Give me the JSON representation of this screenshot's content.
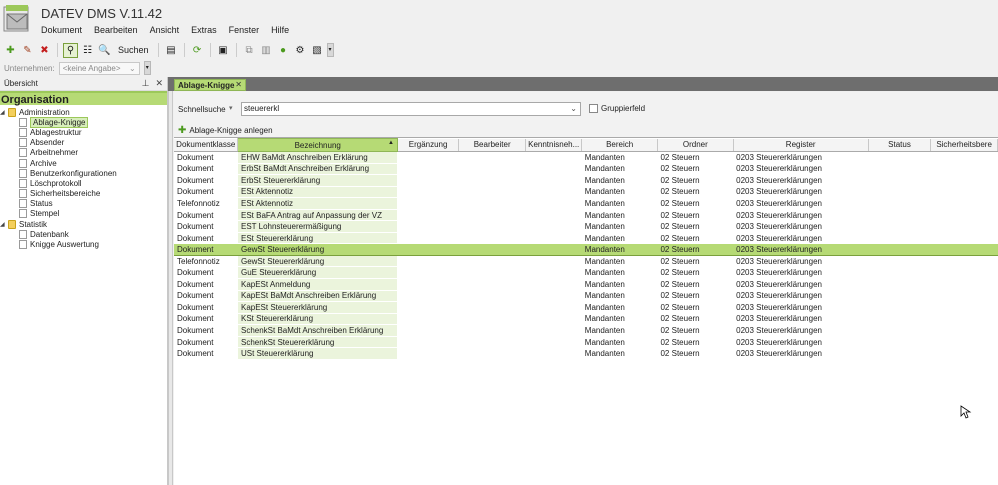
{
  "app": {
    "title": "DATEV DMS V.11.42"
  },
  "menu": [
    {
      "label": "Dokument"
    },
    {
      "label": "Bearbeiten"
    },
    {
      "label": "Ansicht"
    },
    {
      "label": "Extras"
    },
    {
      "label": "Fenster"
    },
    {
      "label": "Hilfe"
    }
  ],
  "toolbar": {
    "search_label": "Suchen"
  },
  "company": {
    "label": "Unternehmen:",
    "value": "<keine Angabe>"
  },
  "leftpane": {
    "header": "Übersicht",
    "org_title": "Organisation",
    "tree": [
      {
        "label": "Administration",
        "level": 1,
        "type": "folder",
        "expanded": true
      },
      {
        "label": "Ablage-Knigge",
        "level": 2,
        "type": "doc",
        "selected": true
      },
      {
        "label": "Ablagestruktur",
        "level": 2,
        "type": "doc"
      },
      {
        "label": "Absender",
        "level": 2,
        "type": "doc"
      },
      {
        "label": "Arbeitnehmer",
        "level": 2,
        "type": "doc"
      },
      {
        "label": "Archive",
        "level": 2,
        "type": "doc"
      },
      {
        "label": "Benutzerkonfigurationen",
        "level": 2,
        "type": "doc"
      },
      {
        "label": "Löschprotokoll",
        "level": 2,
        "type": "doc"
      },
      {
        "label": "Sicherheitsbereiche",
        "level": 2,
        "type": "doc"
      },
      {
        "label": "Status",
        "level": 2,
        "type": "doc"
      },
      {
        "label": "Stempel",
        "level": 2,
        "type": "doc"
      },
      {
        "label": "Statistik",
        "level": 1,
        "type": "folder",
        "expanded": true
      },
      {
        "label": "Datenbank",
        "level": 2,
        "type": "doc"
      },
      {
        "label": "Knigge Auswertung",
        "level": 2,
        "type": "doc"
      }
    ]
  },
  "tab": {
    "label": "Ablage-Knigge"
  },
  "main": {
    "quicksearch_label": "Schnellsuche",
    "quicksearch_value": "steuererkl",
    "group_label": "Gruppierfeld",
    "add_label": "Ablage-Knigge anlegen"
  },
  "colors": {
    "accent": "#b6da75",
    "accent_border": "#8fb656",
    "title_bar": "#6e6e6e"
  },
  "table": {
    "columns": [
      "Dokumentklasse",
      "Bezeichnung",
      "Ergänzung",
      "Bearbeiter",
      "Kenntnisneh...",
      "Bereich",
      "Ordner",
      "Register",
      "Status",
      "Sicherheitsbere"
    ],
    "sorted_column": 1,
    "selected_row": 8,
    "rows": [
      [
        "Dokument",
        "EHW BaMdt Anschreiben Erklärung",
        "",
        "",
        "",
        "Mandanten",
        "02 Steuern",
        "0203 Steuererklärungen",
        "",
        ""
      ],
      [
        "Dokument",
        "ErbSt BaMdt Anschreiben Erklärung",
        "",
        "",
        "",
        "Mandanten",
        "02 Steuern",
        "0203 Steuererklärungen",
        "",
        ""
      ],
      [
        "Dokument",
        "ErbSt Steuererklärung",
        "",
        "",
        "",
        "Mandanten",
        "02 Steuern",
        "0203 Steuererklärungen",
        "",
        ""
      ],
      [
        "Dokument",
        "ESt Aktennotiz",
        "",
        "",
        "",
        "Mandanten",
        "02 Steuern",
        "0203 Steuererklärungen",
        "",
        ""
      ],
      [
        "Telefonnotiz",
        "ESt Aktennotiz",
        "",
        "",
        "",
        "Mandanten",
        "02 Steuern",
        "0203 Steuererklärungen",
        "",
        ""
      ],
      [
        "Dokument",
        "ESt BaFA Antrag auf Anpassung der VZ",
        "",
        "",
        "",
        "Mandanten",
        "02 Steuern",
        "0203 Steuererklärungen",
        "",
        ""
      ],
      [
        "Dokument",
        "EST Lohnsteuerermäßigung",
        "",
        "",
        "",
        "Mandanten",
        "02 Steuern",
        "0203 Steuererklärungen",
        "",
        ""
      ],
      [
        "Dokument",
        "ESt Steuererklärung",
        "",
        "",
        "",
        "Mandanten",
        "02 Steuern",
        "0203 Steuererklärungen",
        "",
        ""
      ],
      [
        "Dokument",
        "GewSt Steuererklärung",
        "",
        "",
        "",
        "Mandanten",
        "02 Steuern",
        "0203 Steuererklärungen",
        "",
        ""
      ],
      [
        "Telefonnotiz",
        "GewSt Steuererklärung",
        "",
        "",
        "",
        "Mandanten",
        "02 Steuern",
        "0203 Steuererklärungen",
        "",
        ""
      ],
      [
        "Dokument",
        "GuE Steuererklärung",
        "",
        "",
        "",
        "Mandanten",
        "02 Steuern",
        "0203 Steuererklärungen",
        "",
        ""
      ],
      [
        "Dokument",
        "KapESt Anmeldung",
        "",
        "",
        "",
        "Mandanten",
        "02 Steuern",
        "0203 Steuererklärungen",
        "",
        ""
      ],
      [
        "Dokument",
        "KapESt BaMdt Anschreiben Erklärung",
        "",
        "",
        "",
        "Mandanten",
        "02 Steuern",
        "0203 Steuererklärungen",
        "",
        ""
      ],
      [
        "Dokument",
        "KapESt Steuererklärung",
        "",
        "",
        "",
        "Mandanten",
        "02 Steuern",
        "0203 Steuererklärungen",
        "",
        ""
      ],
      [
        "Dokument",
        "KSt Steuererklärung",
        "",
        "",
        "",
        "Mandanten",
        "02 Steuern",
        "0203 Steuererklärungen",
        "",
        ""
      ],
      [
        "Dokument",
        "SchenkSt BaMdt Anschreiben Erklärung",
        "",
        "",
        "",
        "Mandanten",
        "02 Steuern",
        "0203 Steuererklärungen",
        "",
        ""
      ],
      [
        "Dokument",
        "SchenkSt Steuererklärung",
        "",
        "",
        "",
        "Mandanten",
        "02 Steuern",
        "0203 Steuererklärungen",
        "",
        ""
      ],
      [
        "Dokument",
        "USt Steuererklärung",
        "",
        "",
        "",
        "Mandanten",
        "02 Steuern",
        "0203 Steuererklärungen",
        "",
        ""
      ]
    ]
  }
}
